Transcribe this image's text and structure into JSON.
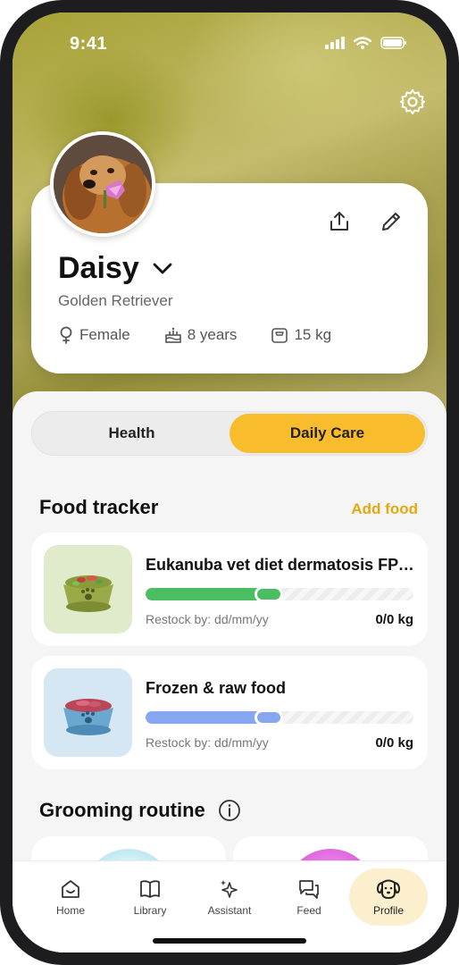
{
  "status": {
    "time": "9:41"
  },
  "pet": {
    "name": "Daisy",
    "breed": "Golden Retriever",
    "sex": "Female",
    "age": "8 years",
    "weight": "15 kg"
  },
  "tabs": [
    {
      "label": "Health",
      "active": false
    },
    {
      "label": "Daily Care",
      "active": true
    }
  ],
  "food_tracker": {
    "title": "Food tracker",
    "add_label": "Add food",
    "items": [
      {
        "name": "Eukanuba vet diet dermatosis FP d...",
        "restock": "Restock by: dd/mm/yy",
        "quantity": "0/0 kg",
        "bar_color": "#4cbe62",
        "thumb_bg": "#e0ebcc",
        "fill_fraction": 0.46
      },
      {
        "name": "Frozen & raw food",
        "restock": "Restock by: dd/mm/yy",
        "quantity": "0/0 kg",
        "bar_color": "#86a7f0",
        "thumb_bg": "#d5e7f3",
        "fill_fraction": 0.46
      }
    ]
  },
  "grooming": {
    "title": "Grooming routine"
  },
  "nav": [
    {
      "label": "Home",
      "icon": "home-icon"
    },
    {
      "label": "Library",
      "icon": "book-icon"
    },
    {
      "label": "Assistant",
      "icon": "sparkle-icon"
    },
    {
      "label": "Feed",
      "icon": "chat-icon"
    },
    {
      "label": "Profile",
      "icon": "dog-icon",
      "active": true
    }
  ],
  "colors": {
    "accent": "#f8bc2c",
    "accent_text": "#e6a80f"
  }
}
